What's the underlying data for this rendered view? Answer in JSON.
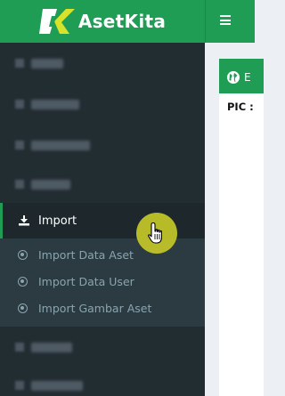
{
  "brand": {
    "name": "AsetKita"
  },
  "sidebar": {
    "import": {
      "label": "Import"
    },
    "submenu": [
      {
        "label": "Import Data Aset"
      },
      {
        "label": "Import Data User"
      },
      {
        "label": "Import Gambar Aset"
      }
    ]
  },
  "content": {
    "box_title": "E",
    "pic_label": "PIC :"
  },
  "colors": {
    "brand_green": "#1f9d55",
    "sidebar_bg": "#222d32",
    "submenu_bg": "#2c3b41",
    "submenu_text": "#8aa4af",
    "cursor_highlight": "#c6c828"
  }
}
